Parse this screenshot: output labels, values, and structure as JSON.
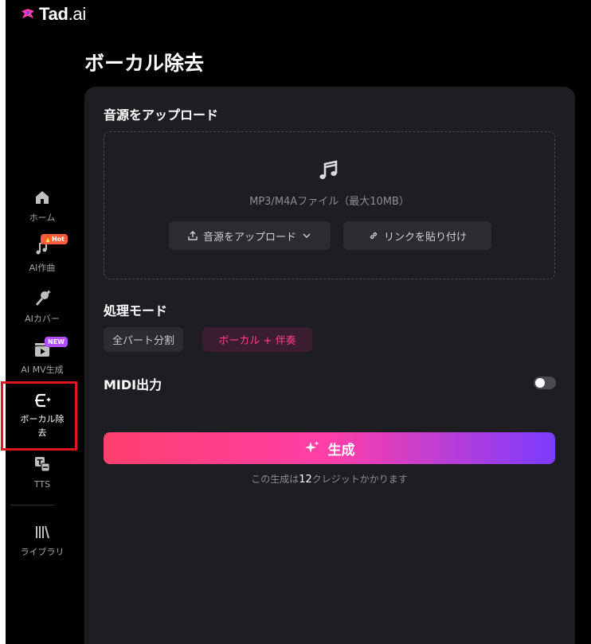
{
  "app": {
    "logo_text": "Tad",
    "logo_suffix": ".ai"
  },
  "sidebar": {
    "items": [
      {
        "label": "ホーム",
        "icon": "home-icon"
      },
      {
        "label": "AI作曲",
        "icon": "music-sparkle-icon",
        "badge": "Hot"
      },
      {
        "label": "AIカバー",
        "icon": "microphone-icon"
      },
      {
        "label": "AI MV生成",
        "icon": "clapperboard-icon",
        "badge": "NEW"
      },
      {
        "label": "ボーカル除\n去",
        "icon": "vocal-remove-icon",
        "active": true
      },
      {
        "label": "TTS",
        "icon": "tts-icon"
      },
      {
        "label": "ライブラリ",
        "icon": "library-icon"
      }
    ]
  },
  "main": {
    "title": "ボーカル除去",
    "upload": {
      "title": "音源をアップロード",
      "hint": "MP3/M4Aファイル（最大10MB）",
      "upload_button": "音源をアップロード",
      "link_button": "リンクを貼り付け"
    },
    "mode": {
      "title": "処理モード",
      "options": [
        "全パート分割",
        "ボーカル + 伴奏"
      ],
      "selected": "ボーカル + 伴奏"
    },
    "midi": {
      "label": "MIDI出力",
      "enabled": false
    },
    "generate": {
      "label": "生成",
      "credit_prefix": "この生成は",
      "credit_value": "12",
      "credit_suffix": "クレジットかかります"
    }
  },
  "colors": {
    "accent_pink": "#ff3f8a",
    "gradient_start": "#ff3f6c",
    "gradient_end": "#7b3cff",
    "panel": "#1d1d22",
    "highlight_box": "#e0161f"
  }
}
